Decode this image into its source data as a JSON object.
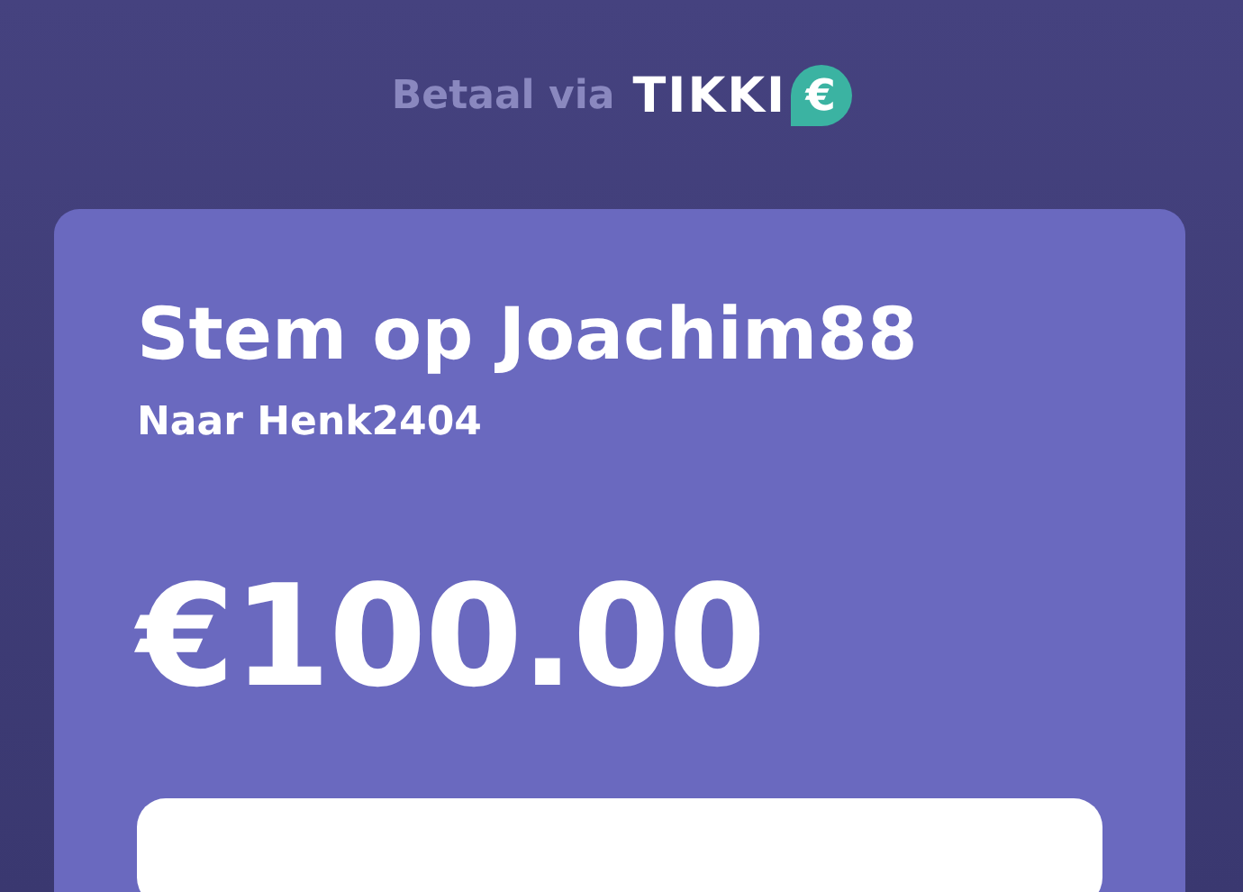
{
  "header": {
    "prefix": "Betaal via",
    "brand": "TIKKI",
    "brand_symbol": "€"
  },
  "request": {
    "title": "Stem op Joachim88",
    "recipient": "Naar Henk2404",
    "amount": "€100.00"
  }
}
